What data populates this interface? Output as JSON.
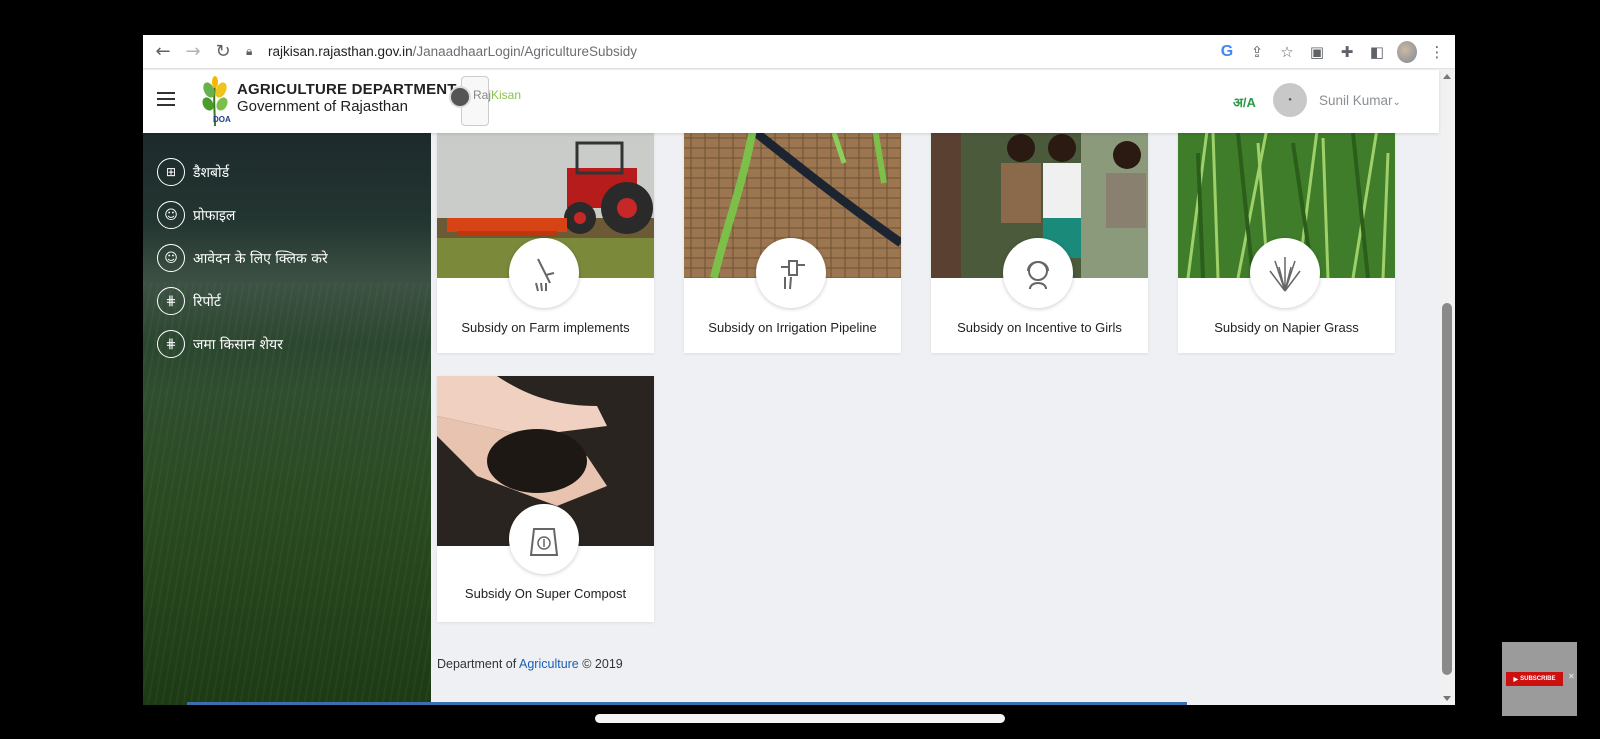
{
  "browser": {
    "url_host": "rajkisan.rajasthan.gov.in",
    "url_path": "/JanaadhaarLogin/AgricultureSubsidy",
    "icons": [
      "back-icon",
      "forward-icon",
      "reload-icon",
      "lock-icon",
      "google-icon",
      "share-icon",
      "star-icon",
      "extension-icon",
      "puzzle-icon",
      "sidepanel-icon",
      "profile-icon",
      "menu-dots-icon"
    ]
  },
  "header": {
    "title": "AGRICULTURE DEPARTMENT",
    "subtitle": "Government of Rajasthan",
    "logo_text": "DOA",
    "app_logo_raj": "Raj",
    "app_logo_kisan": "Kisan",
    "lang_toggle": "अ/A",
    "user_name": "Sunil Kumar"
  },
  "sidebar": {
    "items": [
      {
        "label": "डैशबोर्ड",
        "icon": "dashboard-icon"
      },
      {
        "label": "प्रोफाइल",
        "icon": "profile-icon"
      },
      {
        "label": "आवेदन के लिए क्लिक करे",
        "icon": "apply-icon"
      },
      {
        "label": "रिपोर्ट",
        "icon": "report-icon"
      },
      {
        "label": "जमा किसान शेयर",
        "icon": "share-icon"
      }
    ]
  },
  "cards": [
    {
      "label": "Subsidy on Farm implements",
      "icon": "farm-tool-icon"
    },
    {
      "label": "Subsidy on Irrigation Pipeline",
      "icon": "irrigation-tap-icon"
    },
    {
      "label": "Subsidy on Incentive to Girls",
      "icon": "girl-icon"
    },
    {
      "label": "Subsidy on Napier Grass",
      "icon": "grass-icon"
    },
    {
      "label": "Subsidy On Super Compost",
      "icon": "compost-bag-icon"
    }
  ],
  "footer": {
    "prefix": "Department of",
    "link": "Agriculture",
    "suffix": "© 2019"
  },
  "overlay": {
    "subscribe": "SUBSCRIBE"
  },
  "colors": {
    "accent_green": "#2e9a4a",
    "link_blue": "#1a5fb4",
    "page_bg": "#eef0f3"
  }
}
